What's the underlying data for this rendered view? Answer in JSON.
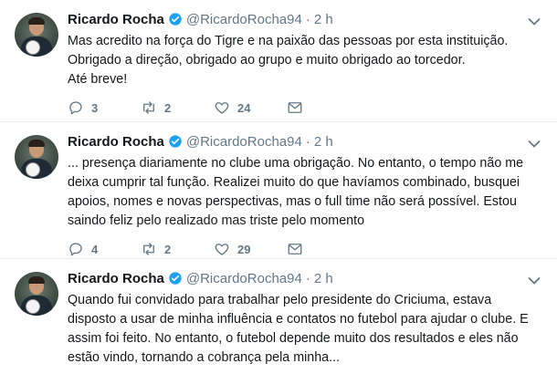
{
  "tweets": [
    {
      "name": "Ricardo Rocha",
      "handle": "@RicardoRocha94",
      "separator": "·",
      "time": "2 h",
      "lines": [
        "Mas acredito na força do Tigre e na paixão das pessoas por esta instituição.",
        "Obrigado a direção, obrigado ao grupo e muito obrigado ao torcedor.",
        "Até breve!"
      ],
      "replies": "3",
      "retweets": "2",
      "likes": "24"
    },
    {
      "name": "Ricardo Rocha",
      "handle": "@RicardoRocha94",
      "separator": "·",
      "time": "2 h",
      "lines": [
        "... presença diariamente no clube uma obrigação. No entanto, o tempo não me deixa cumprir tal função. Realizei muito do que havíamos combinado, busquei apoios, nomes e novas perspectivas, mas o full time não será possível. Estou saindo feliz pelo realizado mas triste pelo momento"
      ],
      "replies": "4",
      "retweets": "2",
      "likes": "29"
    },
    {
      "name": "Ricardo Rocha",
      "handle": "@RicardoRocha94",
      "separator": "·",
      "time": "2 h",
      "lines": [
        "Quando fui convidado para trabalhar pelo presidente do Criciuma, estava disposto a usar de minha influência e contatos no futebol para ajudar o clube. E assim foi feito. No entanto, o futebol depende muito dos resultados e eles não estão vindo, tornando a cobrança pela minha..."
      ]
    }
  ],
  "colors": {
    "text": "#14171a",
    "muted": "#657786",
    "verified": "#1da1f2",
    "divider": "#e6ecf0"
  },
  "icons": [
    "reply-icon",
    "retweet-icon",
    "like-icon",
    "message-icon",
    "verified-badge-icon",
    "chevron-down-icon"
  ]
}
